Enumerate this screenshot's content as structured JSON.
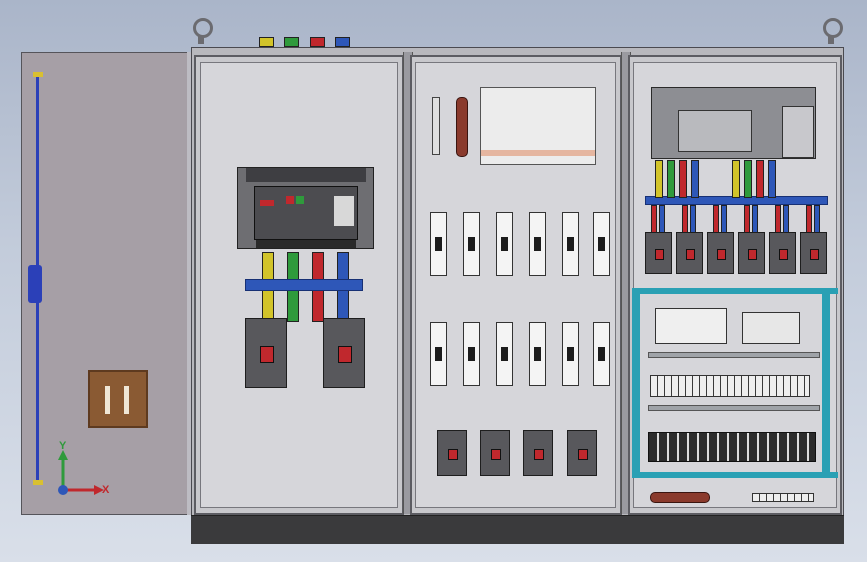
{
  "triad": {
    "x_label": "X",
    "y_label": "Y"
  },
  "colors": {
    "background_top": "#aab5c9",
    "cabinet_gray": "#b8b8bd",
    "door": "#a69fa6",
    "busbar_blue": "#2e57b8",
    "busbar_yellow": "#d2c42a",
    "busbar_green": "#2f9a3c",
    "busbar_red": "#c0282d",
    "teal_panel": "#2aa0b4",
    "socket_brown": "#8a5a33"
  },
  "icons": {
    "lifting_eye": "lifting-eye-icon",
    "coordinate_triad": "axis-triad-icon"
  }
}
